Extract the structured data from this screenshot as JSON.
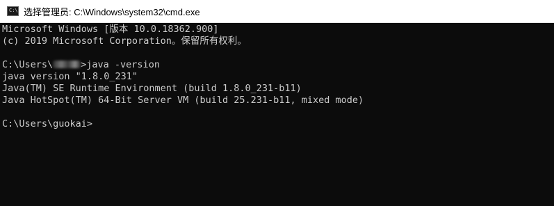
{
  "window": {
    "title": "选择管理员: C:\\Windows\\system32\\cmd.exe",
    "icon": "cmd-console-icon",
    "icon_text": "C:\\"
  },
  "console": {
    "lines": [
      "Microsoft Windows [版本 10.0.18362.900]",
      "(c) 2019 Microsoft Corporation。保留所有权利。",
      "",
      "",
      "java version \"1.8.0_231\"",
      "Java(TM) SE Runtime Environment (build 1.8.0_231-b11)",
      "Java HotSpot(TM) 64-Bit Server VM (build 25.231-b11, mixed mode)",
      "",
      "C:\\Users\\guokai>"
    ],
    "prompt_prefix": "C:\\Users\\",
    "prompt_command": ">java -version"
  },
  "colors": {
    "background": "#0c0c0c",
    "text": "#cccccc",
    "titlebar": "#ffffff"
  }
}
